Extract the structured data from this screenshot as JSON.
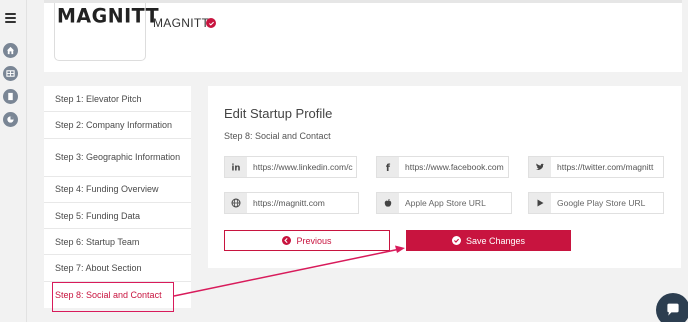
{
  "header": {
    "logo_text": "MAGNITT",
    "company_name": "MAGNITT"
  },
  "sidebar": {
    "steps": [
      {
        "label": "Step 1: Elevator Pitch"
      },
      {
        "label": "Step 2: Company Information"
      },
      {
        "label": "Step 3: Geographic Information"
      },
      {
        "label": "Step 4: Funding Overview"
      },
      {
        "label": "Step 5: Funding Data"
      },
      {
        "label": "Step 6: Startup Team"
      },
      {
        "label": "Step 7: About Section"
      },
      {
        "label": "Step 8: Social and Contact"
      }
    ],
    "active_index": 7
  },
  "panel": {
    "title": "Edit Startup Profile",
    "subtitle": "Step 8: Social and Contact",
    "fields": {
      "linkedin": {
        "value": "https://www.linkedin.com/c",
        "icon": "linkedin-icon"
      },
      "facebook": {
        "value": "https://www.facebook.com",
        "icon": "facebook-icon"
      },
      "twitter": {
        "value": "https://twitter.com/magnitt",
        "icon": "twitter-icon"
      },
      "website": {
        "value": "https://magnitt.com",
        "icon": "globe-icon"
      },
      "appstore": {
        "placeholder": "Apple App Store URL",
        "icon": "apple-icon"
      },
      "playstore": {
        "placeholder": "Google Play Store URL",
        "icon": "play-icon"
      }
    },
    "previous_label": "Previous",
    "save_label": "Save Changes"
  },
  "colors": {
    "accent": "#c8143f",
    "annotation": "#d81b5b"
  }
}
